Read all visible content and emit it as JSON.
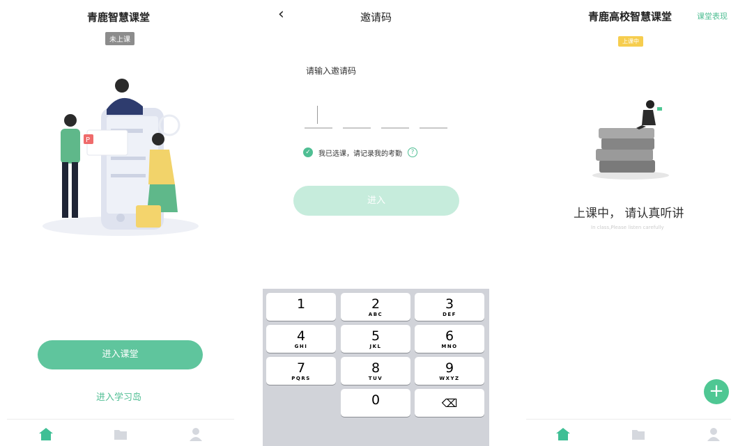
{
  "colors": {
    "accent": "#5fc59d",
    "accent_light": "#c6ecdc",
    "badge_gray": "#8c8c8c",
    "badge_yellow": "#f6cd4e"
  },
  "screen1": {
    "title": "青鹿智慧课堂",
    "badge": "未上课",
    "enter_class_button": "进入课堂",
    "enter_island_link": "进入学习岛"
  },
  "screen2": {
    "title": "邀请码",
    "prompt": "请输入邀请码",
    "consent": "我已选课，请记录我的考勤",
    "help": "?",
    "enter_button": "进入",
    "keys": [
      {
        "n": "1",
        "s": ""
      },
      {
        "n": "2",
        "s": "ABC"
      },
      {
        "n": "3",
        "s": "DEF"
      },
      {
        "n": "4",
        "s": "GHI"
      },
      {
        "n": "5",
        "s": "JKL"
      },
      {
        "n": "6",
        "s": "MNO"
      },
      {
        "n": "7",
        "s": "PQRS"
      },
      {
        "n": "8",
        "s": "TUV"
      },
      {
        "n": "9",
        "s": "WXYZ"
      },
      {
        "n": "",
        "s": ""
      },
      {
        "n": "0",
        "s": ""
      },
      {
        "n": "⌫",
        "s": ""
      }
    ]
  },
  "screen3": {
    "title": "青鹿高校智慧课堂",
    "top_link": "课堂表现",
    "badge": "上课中",
    "status": "上课中， 请认真听讲",
    "status_sub": "In class,Please listen carefully",
    "fab": "+"
  },
  "tabbar_icons": [
    "home-icon",
    "folder-icon",
    "user-icon"
  ]
}
